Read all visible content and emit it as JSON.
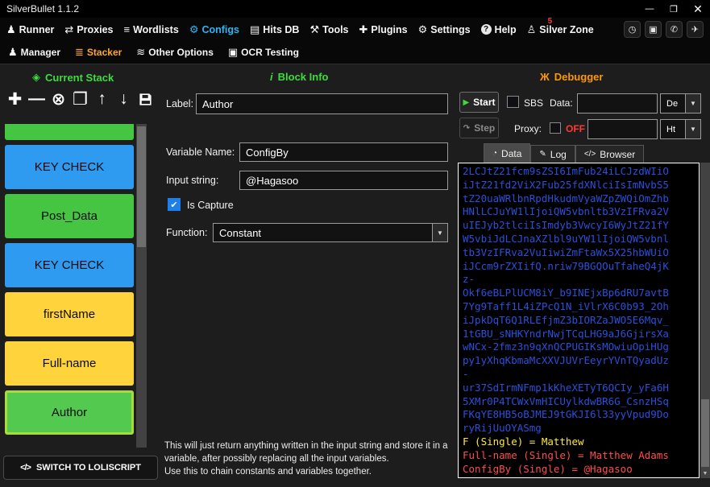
{
  "window": {
    "title": "SilverBullet 1.1.2",
    "minimize": "—",
    "maximize": "❐",
    "close": "✕"
  },
  "icons": {
    "runner": "♟",
    "proxies": "⇄",
    "wordlists": "≡",
    "configs": "⚙",
    "hits_db": "▤",
    "tools": "⚒",
    "plugins": "✚",
    "settings": "⚙",
    "help": "?",
    "silver_zone": "♙",
    "history": "◷",
    "screenshot": "▣",
    "discord": "✆",
    "telegram": "✈",
    "manager": "♟",
    "stacker": "≣",
    "other_options": "≋",
    "ocr": "▣",
    "stack_header": "◈",
    "info": "i",
    "debugger": "Ж",
    "add": "✚",
    "remove": "—",
    "clear": "⊗",
    "duplicate": "❐",
    "move_up": "↑",
    "move_down": "↓",
    "play": "▶",
    "step": "↷",
    "check": "✔",
    "dropdown": "▼",
    "tab_data": "◔",
    "tab_log": "✎",
    "tab_browser": "</>",
    "code": "</>"
  },
  "nav": {
    "items": [
      {
        "label": "Runner"
      },
      {
        "label": "Proxies"
      },
      {
        "label": "Wordlists"
      },
      {
        "label": "Configs",
        "state": "active"
      },
      {
        "label": "Hits DB"
      },
      {
        "label": "Tools"
      },
      {
        "label": "Plugins"
      },
      {
        "label": "Settings"
      },
      {
        "label": "Help"
      },
      {
        "label": "Silver Zone",
        "badge": "5"
      }
    ]
  },
  "subnav": {
    "items": [
      {
        "label": "Manager"
      },
      {
        "label": "Stacker",
        "state": "active"
      },
      {
        "label": "Other Options"
      },
      {
        "label": "OCR Testing"
      }
    ]
  },
  "stack": {
    "header": "Current Stack",
    "blocks": [
      {
        "label": "",
        "color": "green",
        "state": "clipped"
      },
      {
        "label": "KEY CHECK",
        "color": "blue"
      },
      {
        "label": "Post_Data",
        "color": "green"
      },
      {
        "label": "KEY CHECK",
        "color": "blue"
      },
      {
        "label": "firstName",
        "color": "yellow"
      },
      {
        "label": "Full-name",
        "color": "yellow"
      },
      {
        "label": "Author",
        "color": "green",
        "state": "selected"
      }
    ],
    "switch_label": "SWITCH TO LOLISCRIPT"
  },
  "block_info": {
    "header": "Block Info",
    "label": "Label:",
    "label_value": "Author",
    "variable_name_label": "Variable Name:",
    "variable_name_value": "ConfigBy",
    "input_string_label": "Input string:",
    "input_string_value": "@Hagasoo",
    "is_capture_label": "Is Capture",
    "is_capture_checked": true,
    "function_label": "Function:",
    "function_value": "Constant",
    "description": "This will just return anything written in the input string and store it in a variable, after possibly replacing all the input variables.\nUse this to chain constants and variables together."
  },
  "debugger": {
    "header": "Debugger",
    "start_label": "Start",
    "step_label": "Step",
    "sbs_label": "SBS",
    "data_label": "Data:",
    "data_value": "",
    "wordlist_type": "De",
    "proxy_label": "Proxy:",
    "proxy_off": "OFF",
    "proxy_value": "",
    "proxy_type": "Ht",
    "tabs": [
      {
        "label": "Data",
        "state": "active"
      },
      {
        "label": "Log"
      },
      {
        "label": "Browser"
      }
    ],
    "log_lines": [
      {
        "text": "2LCJtZ21fcm9sZSI6ImFub24iLCJzdWIiO",
        "color": "b64"
      },
      {
        "text": "iJtZ21fd2ViX2Fub25fdXNlciIsImNvbS5",
        "color": "b64"
      },
      {
        "text": "tZ20uaWRlbnRpdHkudmVyaWZpZWQiOmZhb",
        "color": "b64"
      },
      {
        "text": "HNlLCJuYW1lIjoiQW5vbnltb3VzIFRva2V",
        "color": "b64"
      },
      {
        "text": "uIEJyb2tlciIsImdyb3VwcyI6WyJtZ21fY",
        "color": "b64"
      },
      {
        "text": "W5vbiJdLCJnaXZlbl9uYW1lIjoiQW5vbnl",
        "color": "b64"
      },
      {
        "text": "tb3VzIFRva2VuIiwiZmFtaWx5X25hbWUiO",
        "color": "b64"
      },
      {
        "text": "iJCcm9rZXIifQ.nriw79BGQOuTfaheQ4jK",
        "color": "b64"
      },
      {
        "text": "z-",
        "color": "b64"
      },
      {
        "text": "Okf6eBLPlUCM8iY_b9INEjxBp6dRU7avtB",
        "color": "b64"
      },
      {
        "text": "7Yg9Taff1L4iZPcQ1N_iVlrX6C0b93_2Oh",
        "color": "b64"
      },
      {
        "text": "iJpkDqT6Q1RLEfjmZ3bIORZaJWO5E6Mqv_",
        "color": "b64"
      },
      {
        "text": "1tGBU_sNHKYndrNwjTCqLHG9aJ6GjirsXa",
        "color": "b64"
      },
      {
        "text": "wNCx-2fmz3n9qXnQCPUGIKsMOwiuOpiHUg",
        "color": "b64"
      },
      {
        "text": "py1yXhqKbmaMcXXVJUVrEeyrYVnTQyadUz",
        "color": "b64"
      },
      {
        "text": "-",
        "color": "b64"
      },
      {
        "text": "ur37SdIrmNFmp1kKheXETyT6QCIy_yFa6H",
        "color": "b64"
      },
      {
        "text": "5XMr0P4TCWxVmHICUylkdwBR6G_CsnzHSq",
        "color": "b64"
      },
      {
        "text": "FKqYE8HB5oBJMEJ9tGKJI6l33yyVpud9Do",
        "color": "b64"
      },
      {
        "text": "ryRijUuOYASmg",
        "color": "b64"
      },
      {
        "text": "F (Single) = Matthew",
        "color": "yellow"
      },
      {
        "text": "Full-name (Single) = Matthew Adams",
        "color": "red"
      },
      {
        "text": "ConfigBy (Single) = @Hagasoo",
        "color": "red"
      }
    ]
  },
  "colors": {
    "accent_configs": "#29b6f6",
    "accent_stacker": "#ffa726",
    "header_green": "#3ddc3d",
    "header_orange": "#ff9800",
    "block_blue": "#2e9bf0",
    "block_green": "#45c542",
    "block_yellow": "#ffd33c",
    "selected_border": "#aadb3c",
    "log_base64": "#2b50db",
    "log_variable": "#ffe93b",
    "log_capture": "#ff4d4d",
    "proxy_off": "#ff3b30",
    "badge_red": "#ff3b30"
  }
}
